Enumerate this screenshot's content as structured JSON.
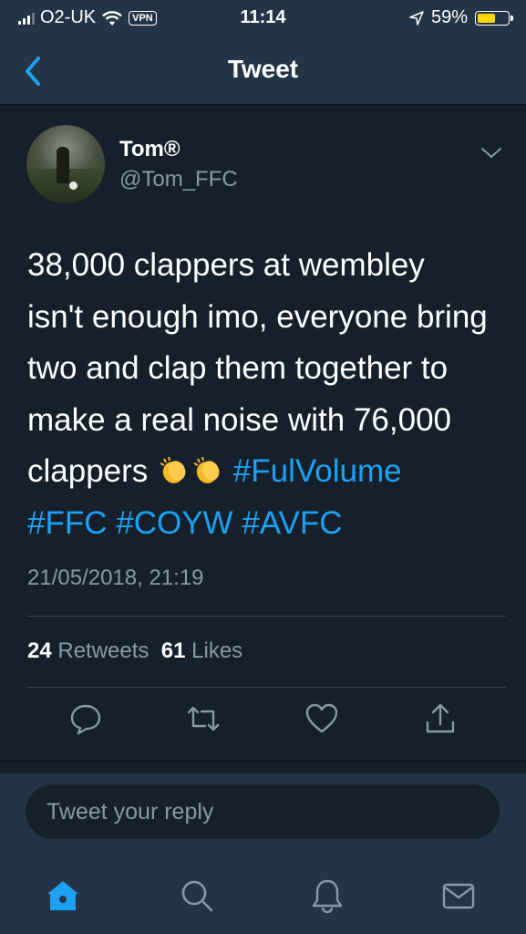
{
  "status": {
    "carrier": "O2-UK",
    "vpn": "VPN",
    "time": "11:14",
    "battery": "59%",
    "battery_level": 0.59,
    "battery_color": "#ffd60a"
  },
  "nav": {
    "title": "Tweet",
    "back_icon": "chevron-left-icon"
  },
  "tweet": {
    "name": "Tom®",
    "handle": "@Tom_FFC",
    "text_line1": "38,000 clappers at wembley",
    "text_line2": "isn't enough imo, everyone bring",
    "text_line3": "two and clap them together to",
    "text_line4": "make a real noise with 76,000",
    "text_line5": "clappers",
    "emoji": "clapping-hands-emoji",
    "hashtag1": "#FulVolume",
    "hashtag2": "#FFC",
    "hashtag3": "#COYW",
    "hashtag4": "#AVFC",
    "timestamp": "21/05/2018, 21:19",
    "retweets_count": "24",
    "retweets_label": "Retweets",
    "likes_count": "61",
    "likes_label": "Likes",
    "accent_color": "#1da1f2"
  },
  "reply": {
    "placeholder": "Tweet your reply"
  },
  "tabs": [
    "home-icon",
    "search-icon",
    "notifications-icon",
    "messages-icon"
  ]
}
